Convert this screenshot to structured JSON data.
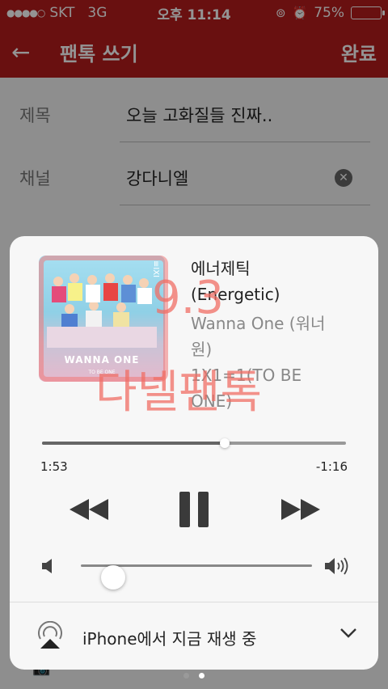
{
  "status_bar": {
    "carrier": "SKT",
    "network": "3G",
    "time": "오후 11:14",
    "battery": "75%",
    "battery_level": 0.75
  },
  "app_bar": {
    "title": "팬톡 쓰기",
    "done_label": "완료"
  },
  "form": {
    "title_label": "제목",
    "title_value": "오늘 고화질들 진짜..",
    "channel_label": "채널",
    "channel_value": "강다니엘"
  },
  "now_playing": {
    "title": "에너제틱 (Energetic)",
    "artist": "Wanna One (워너원)",
    "album": "1X1=1(TO BE ONE)",
    "album_art_text": "WANNA ONE",
    "album_art_subtext": "TO BE ONE",
    "elapsed": "1:53",
    "remaining": "-1:16",
    "progress": 0.6,
    "volume": 0.14,
    "output_device": "iPhone에서 지금 재생 중"
  },
  "watermark": {
    "line1": "9.3",
    "line2": "다넬팬톡"
  },
  "pager": {
    "count": 2,
    "active_index": 1
  },
  "colors": {
    "brand_red": "#b51c1c",
    "panel_bg": "#f7f7f7",
    "watermark": "#f06e64"
  }
}
